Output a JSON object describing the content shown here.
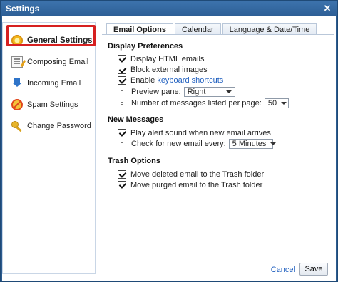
{
  "window": {
    "title": "Settings"
  },
  "sidebar": {
    "items": [
      {
        "label": "General Settings",
        "icon": "gear-icon",
        "active": true
      },
      {
        "label": "Composing Email",
        "icon": "compose-icon"
      },
      {
        "label": "Incoming Email",
        "icon": "inbox-icon"
      },
      {
        "label": "Spam Settings",
        "icon": "spam-icon"
      },
      {
        "label": "Change Password",
        "icon": "key-icon"
      }
    ]
  },
  "tabs": [
    {
      "label": "Email Options",
      "active": true
    },
    {
      "label": "Calendar"
    },
    {
      "label": "Language & Date/Time"
    }
  ],
  "display": {
    "title": "Display Preferences",
    "html_emails": {
      "label": "Display HTML emails",
      "checked": true
    },
    "block_images": {
      "label": "Block external images",
      "checked": true
    },
    "shortcuts": {
      "prefix": "Enable ",
      "link": "keyboard shortcuts",
      "checked": true
    },
    "preview_pane": {
      "label": "Preview pane:",
      "value": "Right"
    },
    "messages_per_page": {
      "label": "Number of messages listed per page:",
      "value": "50"
    }
  },
  "new_messages": {
    "title": "New Messages",
    "alert_sound": {
      "label": "Play alert sound when new email arrives",
      "checked": true
    },
    "check_interval": {
      "label": "Check for new email every:",
      "value": "5 Minutes"
    }
  },
  "trash": {
    "title": "Trash Options",
    "move_deleted": {
      "label": "Move deleted email to the Trash folder",
      "checked": true
    },
    "move_purged": {
      "label": "Move purged email to the Trash folder",
      "checked": true
    }
  },
  "footer": {
    "cancel_label": "Cancel",
    "save_label": "Save"
  },
  "colors": {
    "titlebar": "#2c5e95",
    "highlight": "#d62020",
    "link": "#1f5fbf"
  }
}
